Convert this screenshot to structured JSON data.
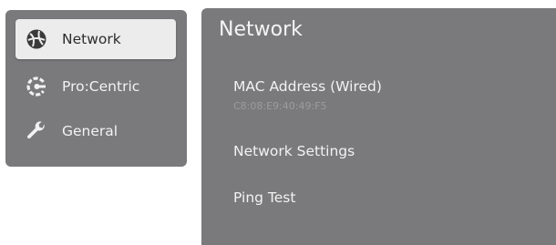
{
  "sidebar": {
    "items": [
      {
        "label": "Network",
        "icon": "globe-icon",
        "selected": true
      },
      {
        "label": "Pro:Centric",
        "icon": "procentric-icon",
        "selected": false
      },
      {
        "label": "General",
        "icon": "wrench-icon",
        "selected": false
      }
    ]
  },
  "detail": {
    "title": "Network",
    "mac": {
      "label": "MAC Address (Wired)",
      "value": "C8:08:E9:40:49:F5"
    },
    "network_settings": {
      "label": "Network Settings"
    },
    "ping_test": {
      "label": "Ping Test"
    }
  },
  "colors": {
    "panel": "#7a7a7c",
    "selected_bg": "#ececec",
    "text_light": "#f2f2f2",
    "text_dark": "#2c2c2c",
    "subtext": "#9c9c9e"
  }
}
